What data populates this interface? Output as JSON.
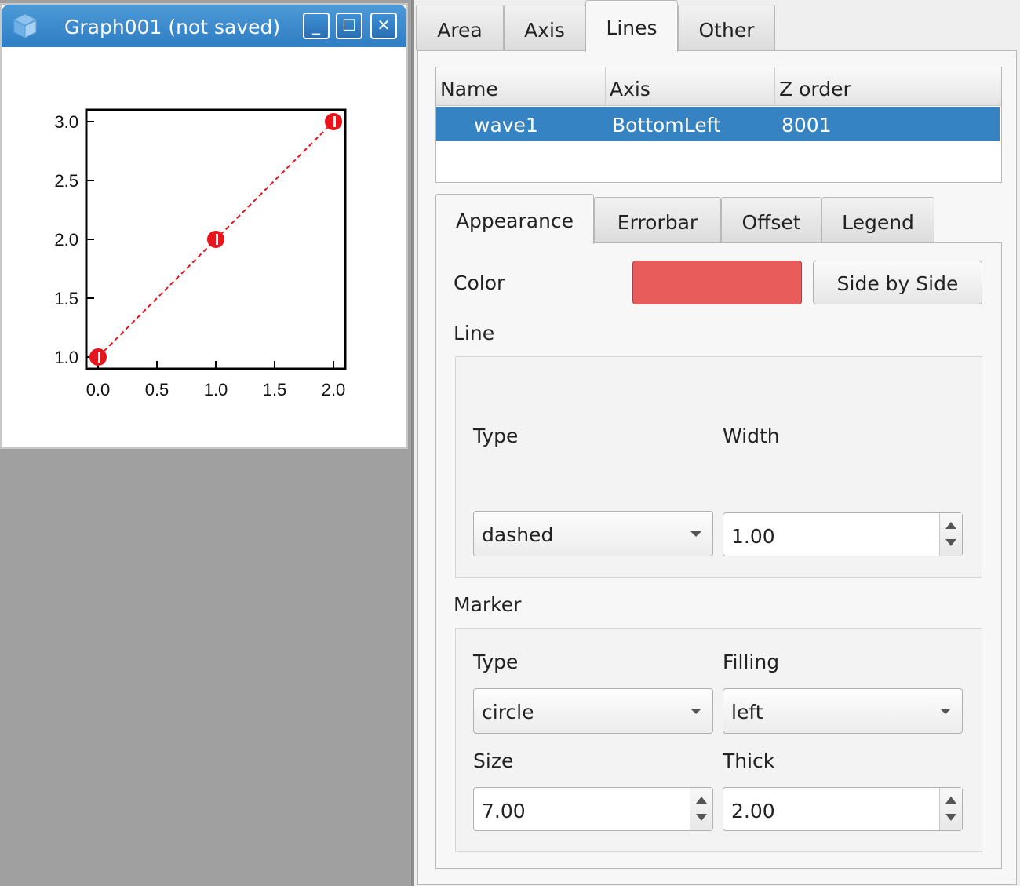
{
  "graph_window": {
    "title": "Graph001 (not saved)",
    "buttons": {
      "minimize": "_",
      "maximize": "☐",
      "close": "✕"
    }
  },
  "chart_data": {
    "type": "line",
    "x": [
      0.0,
      1.0,
      2.0
    ],
    "series": [
      {
        "values": [
          1.0,
          2.0,
          3.0
        ],
        "color": "#e8141c",
        "line": "dashed",
        "marker": "circle",
        "filling": "left"
      }
    ],
    "xlim": [
      -0.1,
      2.1
    ],
    "ylim": [
      0.9,
      3.1
    ],
    "xticks": [
      0.0,
      0.5,
      1.0,
      1.5,
      2.0
    ],
    "yticks": [
      1.0,
      1.5,
      2.0,
      2.5,
      3.0
    ],
    "xtick_labels": [
      "0.0",
      "0.5",
      "1.0",
      "1.5",
      "2.0"
    ],
    "ytick_labels": [
      "1.0",
      "1.5",
      "2.0",
      "2.5",
      "3.0"
    ],
    "grid": false
  },
  "panel": {
    "tabs": [
      {
        "label": "Area"
      },
      {
        "label": "Axis"
      },
      {
        "label": "Lines",
        "active": true
      },
      {
        "label": "Other"
      }
    ],
    "table": {
      "columns": [
        "Name",
        "Axis",
        "Z order"
      ],
      "rows": [
        {
          "name": "wave1",
          "axis": "BottomLeft",
          "z_order": "8001",
          "selected": true
        }
      ]
    },
    "subtabs": [
      {
        "label": "Appearance",
        "active": true
      },
      {
        "label": "Errorbar"
      },
      {
        "label": "Offset"
      },
      {
        "label": "Legend"
      }
    ],
    "appearance": {
      "color_label": "Color",
      "color_value": "#e85c5c",
      "side_by_side_label": "Side by Side",
      "line": {
        "section_label": "Line",
        "type_label": "Type",
        "type_value": "dashed",
        "width_label": "Width",
        "width_value": "1.00"
      },
      "marker": {
        "section_label": "Marker",
        "type_label": "Type",
        "type_value": "circle",
        "filling_label": "Filling",
        "filling_value": "left",
        "size_label": "Size",
        "size_value": "7.00",
        "thick_label": "Thick",
        "thick_value": "2.00"
      }
    }
  }
}
